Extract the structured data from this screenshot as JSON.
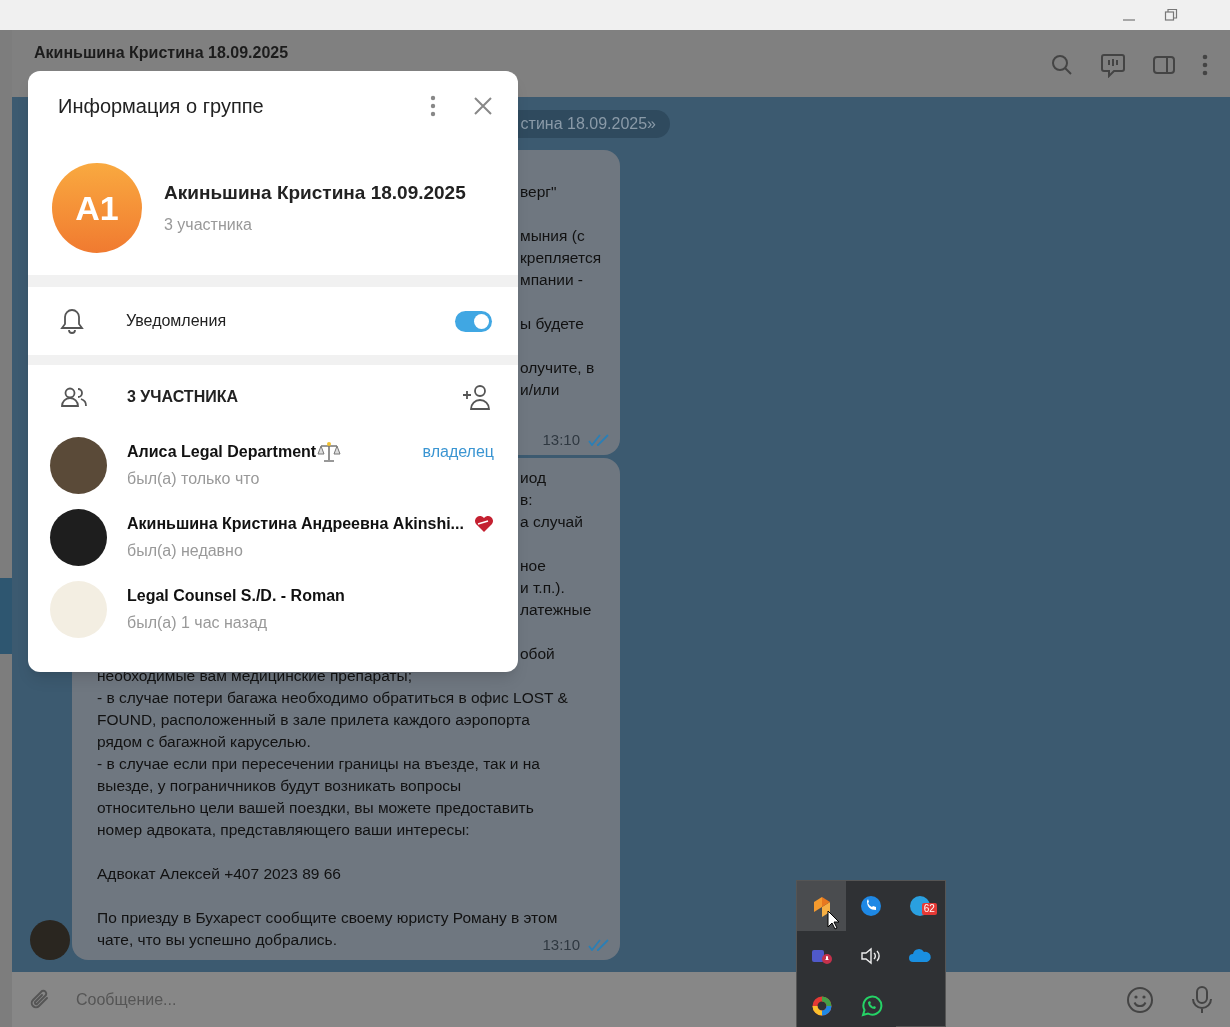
{
  "chat_header": {
    "title": "Акиньшина Кристина 18.09.2025"
  },
  "date_pill": "стина 18.09.2025»",
  "messages": [
    {
      "paragraphs": [
        [
          {
            "text": "верг\"",
            "cut": true
          }
        ],
        [
          {
            "text": "мыния (с",
            "cut": true
          },
          {
            "text": "крепляется",
            "cut": true
          },
          {
            "text": "мпании -",
            "cut": true
          }
        ],
        [
          {
            "text": "ы будете",
            "cut": true
          }
        ],
        [
          {
            "text": "олучите, в",
            "cut": true
          },
          {
            "text": "и/или",
            "cut": true
          }
        ]
      ],
      "time": "13:10",
      "read": true,
      "avatar": false
    },
    {
      "paragraphs": [
        [
          {
            "text": "иод",
            "cut": true
          },
          {
            "text": "в:",
            "cut": true
          },
          {
            "text": "а случай",
            "cut": true
          }
        ],
        [
          {
            "text": "ное",
            "cut": true
          },
          {
            "text": "и т.п.).",
            "cut": true
          },
          {
            "text": "латежные",
            "cut": true
          }
        ],
        [
          {
            "text": "обой",
            "cut": true
          },
          {
            "text": "необходимые вам медицинские препараты;",
            "cut": false
          },
          {
            "text": "- в случае потери багажа необходимо обратиться в офис LOST &",
            "cut": false
          },
          {
            "text": "FOUND, расположенный в зале прилета каждого аэропорта",
            "cut": false
          },
          {
            "text": "рядом с багажной каруселью.",
            "cut": false
          },
          {
            "text": "- в случае если при пересечении границы на въезде, так и на",
            "cut": false
          },
          {
            "text": "выезде, у пограничников будут возникать вопросы",
            "cut": false
          },
          {
            "text": "относительно цели вашей поездки, вы можете предоставить",
            "cut": false
          },
          {
            "text": "номер адвоката, представляющего ваши интересы:",
            "cut": false
          }
        ],
        [
          {
            "text": "Адвокат Алексей +407 2023 89 66",
            "cut": false
          }
        ],
        [
          {
            "text": "По приезду в Бухарест сообщите своему юристу Роману в этом",
            "cut": false
          },
          {
            "text": "чате, что вы успешно добрались.",
            "cut": false
          }
        ]
      ],
      "time": "13:10",
      "read": true,
      "avatar": true
    }
  ],
  "composer": {
    "placeholder": "Сообщение..."
  },
  "dialog": {
    "title": "Информация о группе",
    "group": {
      "initials": "A1",
      "name": "Акиньшина Кристина 18.09.2025",
      "subtitle": "3 участника"
    },
    "notifications": {
      "label": "Уведомления",
      "on": true
    },
    "members_header": "3 УЧАСТНИКА",
    "members": [
      {
        "name": "Алиса Legal Department",
        "status": "был(а) только что",
        "role": "владелец",
        "emoji_status": true
      },
      {
        "name": "Акиньшина Кристина Андреевна Akinshi...",
        "status": "был(а) недавно",
        "emoji_status": true
      },
      {
        "name": "Legal Counsel S./D. - Roman",
        "status": "был(а) 1 час назад",
        "emoji_status": false
      }
    ]
  },
  "tray": {
    "items": [
      {
        "kind": "orange-app",
        "hovered": true
      },
      {
        "kind": "phone",
        "hovered": false
      },
      {
        "kind": "messenger",
        "hovered": false,
        "badge": "62"
      },
      {
        "kind": "teams",
        "hovered": false
      },
      {
        "kind": "speaker",
        "hovered": false
      },
      {
        "kind": "cloud",
        "hovered": false
      },
      {
        "kind": "ring",
        "hovered": false
      },
      {
        "kind": "whatsapp",
        "hovered": false
      }
    ]
  }
}
